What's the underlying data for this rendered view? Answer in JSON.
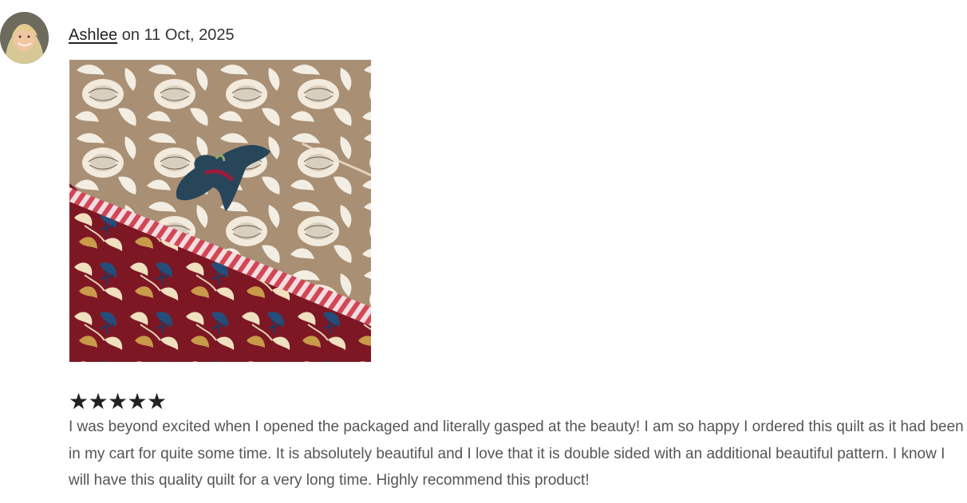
{
  "review": {
    "author": "Ashlee",
    "date_prefix": "on",
    "date": "11 Oct, 2025",
    "rating": 5,
    "rating_symbols": [
      "★",
      "★",
      "★",
      "★",
      "★"
    ],
    "text": "I was beyond excited when I opened the packaged and literally gasped at the beauty! I am so happy I ordered this quilt as it had been in my cart for quite some time. It is absolutely beautiful and I love that it is double sided with an additional beautiful pattern. I know I will have this quality quilt for a very long time. Highly recommend this product!"
  },
  "colors": {
    "text_dark": "#222222",
    "text_body": "#555555",
    "quilt_tan": "#a98f73",
    "quilt_maroon": "#7d1724",
    "stripe_pink": "#d24755"
  },
  "icons": {
    "avatar": "reviewer-avatar",
    "star": "star-filled-icon"
  }
}
